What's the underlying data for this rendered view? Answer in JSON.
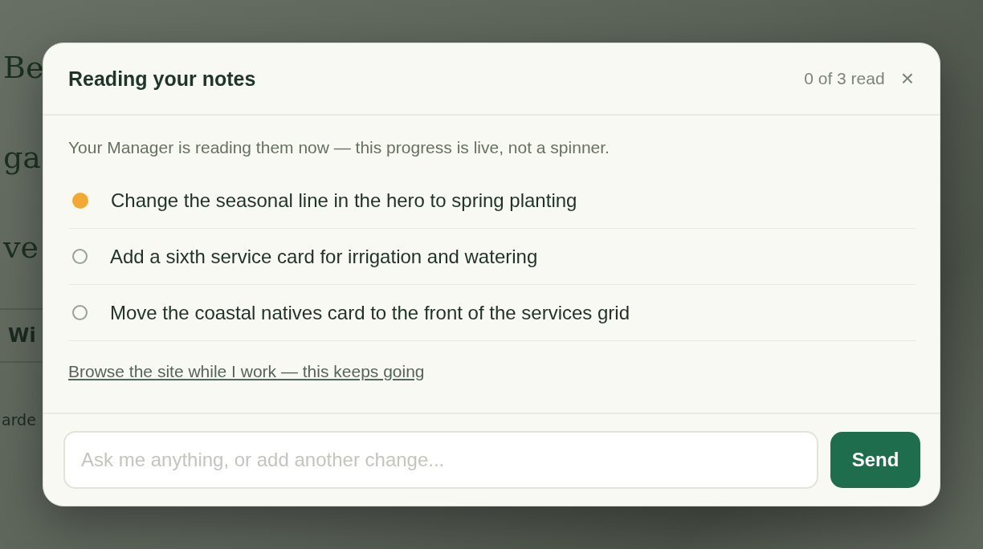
{
  "background": {
    "heading_lines": [
      "Be",
      "ga",
      "ve"
    ],
    "tab": "Wi",
    "text": "arde"
  },
  "dialog": {
    "title": "Reading your notes",
    "counter": "0 of 3 read",
    "close": "×",
    "subtitle": "Your Manager is reading them now — this progress is live, not a spinner.",
    "items": [
      {
        "text": "Change the seasonal line in the hero to spring planting",
        "active": true
      },
      {
        "text": "Add a sixth service card for irrigation and watering",
        "active": false
      },
      {
        "text": "Move the coastal natives card to the front of the services grid",
        "active": false
      }
    ],
    "link": "Browse the site while I work — this keeps going",
    "input": {
      "placeholder": "Ask me anything, or add another change..."
    },
    "send": "Send"
  }
}
